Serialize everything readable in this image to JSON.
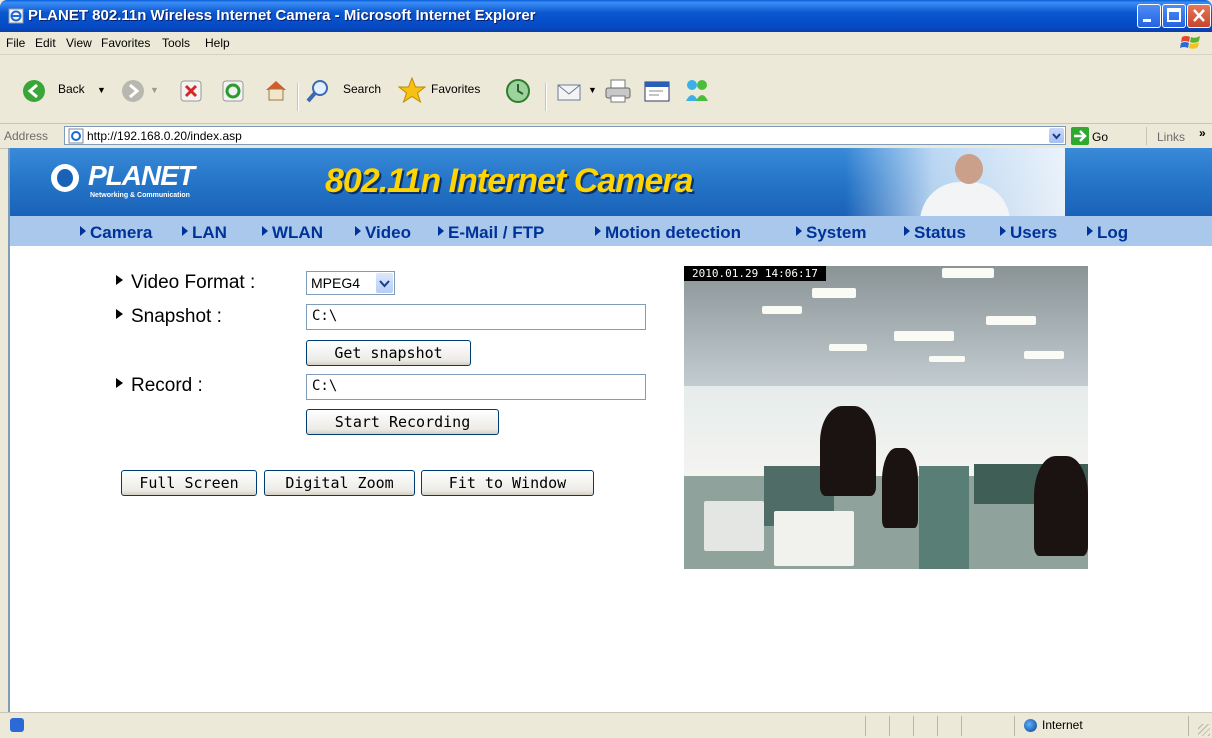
{
  "window": {
    "title": "PLANET 802.11n Wireless Internet Camera - Microsoft Internet Explorer"
  },
  "menu": [
    "File",
    "Edit",
    "View",
    "Favorites",
    "Tools",
    "Help"
  ],
  "toolbar": {
    "back": "Back",
    "search": "Search",
    "favorites": "Favorites"
  },
  "address": {
    "label": "Address",
    "url": "http://192.168.0.20/index.asp",
    "go": "Go",
    "links": "Links"
  },
  "banner": {
    "brand": "PLANET",
    "brand_sub": "Networking & Communication",
    "title": "802.11n Internet Camera"
  },
  "nav": [
    "Camera",
    "LAN",
    "WLAN",
    "Video",
    "E-Mail / FTP",
    "Motion detection",
    "System",
    "Status",
    "Users",
    "Log"
  ],
  "form": {
    "video_format_label": "Video Format :",
    "video_format_value": "MPEG4",
    "snapshot_label": "Snapshot :",
    "snapshot_path": "C:\\",
    "get_snapshot": "Get snapshot",
    "record_label": "Record :",
    "record_path": "C:\\",
    "start_recording": "Start Recording",
    "full_screen": "Full Screen",
    "digital_zoom": "Digital Zoom",
    "fit_to_window": "Fit to Window"
  },
  "video": {
    "timestamp": "2010.01.29 14:06:17"
  },
  "status": {
    "zone": "Internet"
  }
}
